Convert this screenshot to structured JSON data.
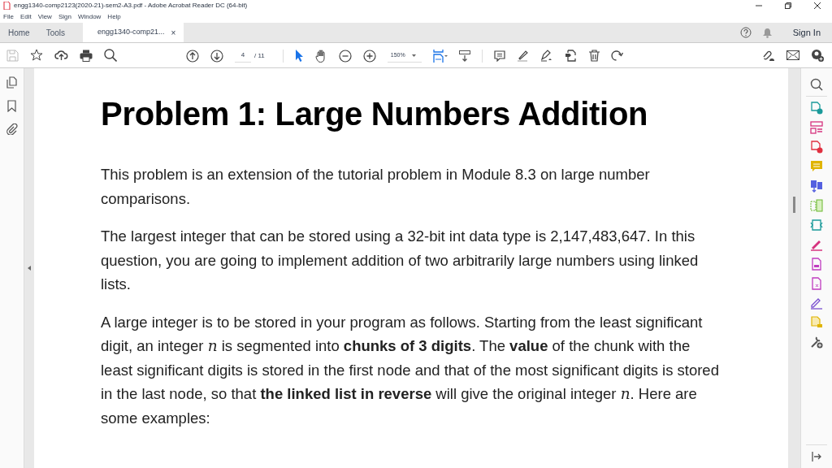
{
  "window": {
    "title": "engg1340-comp2123(2020-21)-sem2-A3.pdf - Adobe Acrobat Reader DC (64-bit)"
  },
  "menu": [
    "File",
    "Edit",
    "View",
    "Sign",
    "Window",
    "Help"
  ],
  "tabs": [
    {
      "label": "Home",
      "selected": false,
      "kind": "nav"
    },
    {
      "label": "Tools",
      "selected": false,
      "kind": "nav"
    },
    {
      "label": "engg1340-comp21...",
      "selected": true,
      "kind": "document",
      "close": "×"
    }
  ],
  "sign_in": "Sign In",
  "toolbar": {
    "page_number": "4",
    "page_total": "/ 11",
    "zoom": "150%"
  },
  "document": {
    "heading": "Problem 1: Large Numbers Addition",
    "paragraphs": [
      "This problem is an extension of the tutorial problem in Module 8.3 on large number comparisons.",
      "The largest integer that can be stored using a 32-bit int data type is 2,147,483,647. In this question, you are going to implement addition of two arbitrarily large numbers using linked lists.",
      "A large integer is to be stored in your program as follows. Starting from the least significant digit, an integer *n* is segmented into **chunks of 3 digits**. The **value** of the chunk with the least significant digits is stored in the first node and that of the most significant digits is stored in the last node, so that **the linked list in reverse** will give the original integer *n*. Here are some examples:"
    ]
  }
}
